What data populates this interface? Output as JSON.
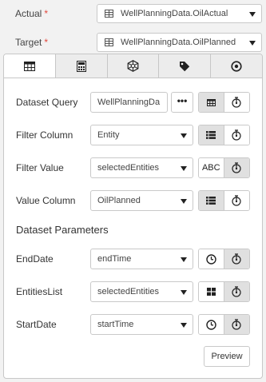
{
  "fields": {
    "actual": {
      "label": "Actual",
      "required": "*",
      "value": "WellPlanningData.OilActual"
    },
    "target": {
      "label": "Target",
      "required": "*",
      "value": "WellPlanningData.OilPlanned"
    }
  },
  "tabs": [
    {
      "icon": "table-icon",
      "active": true
    },
    {
      "icon": "calculator-icon",
      "active": false
    },
    {
      "icon": "hexagon-network-icon",
      "active": false
    },
    {
      "icon": "tag-icon",
      "active": false
    },
    {
      "icon": "target-icon",
      "active": false
    }
  ],
  "rows": {
    "dataset_query": {
      "label": "Dataset Query",
      "value": "WellPlanningDa",
      "more": "•••"
    },
    "filter_column": {
      "label": "Filter Column",
      "value": "Entity"
    },
    "filter_value": {
      "label": "Filter Value",
      "value": "selectedEntities",
      "toggle_text": "ABC"
    },
    "value_column": {
      "label": "Value Column",
      "value": "OilPlanned"
    }
  },
  "dataset_parameters": {
    "title": "Dataset Parameters",
    "items": [
      {
        "label": "EndDate",
        "value": "endTime",
        "type_icon": "clock-icon"
      },
      {
        "label": "EntitiesList",
        "value": "selectedEntities",
        "type_icon": "grid-icon"
      },
      {
        "label": "StartDate",
        "value": "startTime",
        "type_icon": "clock-icon"
      }
    ]
  },
  "buttons": {
    "preview": "Preview"
  }
}
